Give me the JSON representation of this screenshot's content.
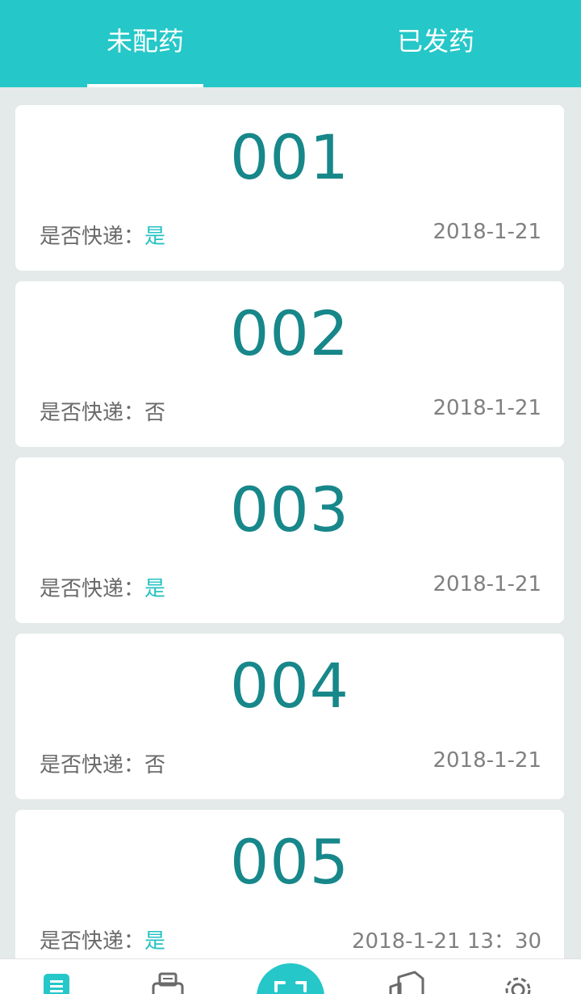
{
  "tabs": [
    {
      "label": "未配药",
      "active": true
    },
    {
      "label": "已发药",
      "active": false
    }
  ],
  "orders": [
    {
      "number": "001",
      "express_label": "是否快递：",
      "express_value": "是",
      "date": "2018-1-21"
    },
    {
      "number": "002",
      "express_label": "是否快递：",
      "express_value": "否",
      "date": "2018-1-21"
    },
    {
      "number": "003",
      "express_label": "是否快递：",
      "express_value": "是",
      "date": "2018-1-21"
    },
    {
      "number": "004",
      "express_label": "是否快递：",
      "express_value": "否",
      "date": "2018-1-21"
    },
    {
      "number": "005",
      "express_label": "是否快递：",
      "express_value": "是",
      "date": "2018-1-21 13：30"
    }
  ],
  "bottom_nav": [
    {
      "icon": "list-icon",
      "active": true
    },
    {
      "icon": "printer-icon",
      "active": false
    },
    {
      "icon": "scan-icon",
      "active": false
    },
    {
      "icon": "document-icon",
      "active": false
    },
    {
      "icon": "gear-icon",
      "active": false
    }
  ],
  "colors": {
    "accent": "#25c7c8",
    "number": "#17878a",
    "yes": "#25c1c4"
  }
}
